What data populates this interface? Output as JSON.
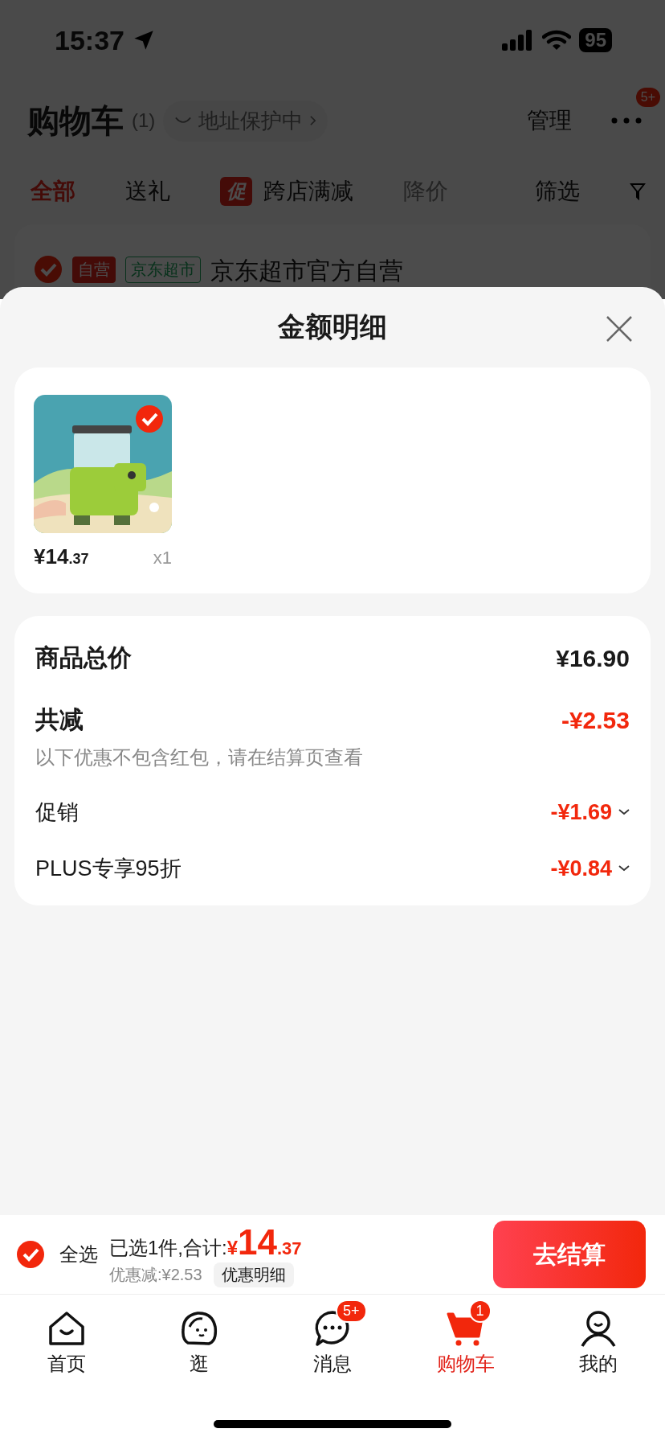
{
  "status_bar": {
    "time": "15:37",
    "battery": "95"
  },
  "header": {
    "title": "购物车",
    "count": "(1)",
    "address_badge": "地址保护中",
    "manage": "管理",
    "more_badge": "5+"
  },
  "filter_tabs": [
    {
      "label": "全部",
      "selected": true,
      "disabled": false
    },
    {
      "label": "送礼",
      "selected": false,
      "disabled": false
    },
    {
      "label": "跨店满减",
      "tag": "促",
      "selected": false,
      "disabled": false
    },
    {
      "label": "降价",
      "selected": false,
      "disabled": true
    }
  ],
  "filter_button": "筛选",
  "store": {
    "checked": true,
    "tags": [
      {
        "label": "自营"
      },
      {
        "label": "京东超市"
      }
    ],
    "name": "京东超市官方自营"
  },
  "sheet": {
    "title": "金额明细",
    "products": [
      {
        "price_main": "¥14",
        "price_decimal": ".37",
        "quantity": "x1",
        "checked": true
      }
    ],
    "summary": {
      "total_label": "商品总价",
      "total": "¥16.90",
      "discount_label": "共减",
      "discount": "-¥2.53",
      "note": "以下优惠不包含红包，请在结算页查看",
      "items": [
        {
          "label": "促销",
          "amount": "-¥1.69"
        },
        {
          "label": "PLUS专享95折",
          "amount": "-¥0.84"
        }
      ]
    }
  },
  "checkout": {
    "select_all_checked": true,
    "select_all": "全选",
    "selected_text": "已选1件,合计:",
    "currency": "¥",
    "total_main": "14",
    "total_decimal": ".37",
    "discount_text": "优惠减:¥2.53",
    "detail_button": "优惠明细",
    "checkout_button": "去结算"
  },
  "tab_bar": [
    {
      "label": "首页",
      "selected": false
    },
    {
      "label": "逛",
      "selected": false
    },
    {
      "label": "消息",
      "badge": "5+",
      "selected": false
    },
    {
      "label": "购物车",
      "badge": "1",
      "selected": true
    },
    {
      "label": "我的",
      "selected": false
    }
  ]
}
